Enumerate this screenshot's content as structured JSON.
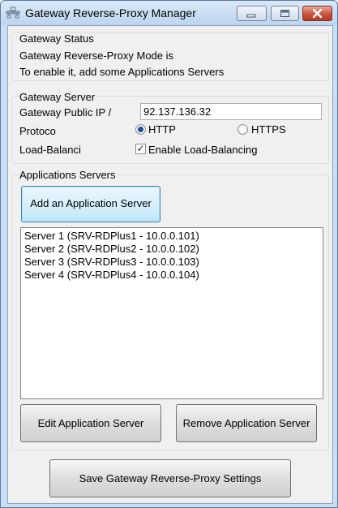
{
  "window": {
    "title": "Gateway Reverse-Proxy Manager",
    "icon": "network-gateway-icon"
  },
  "gateway_status": {
    "group_title": "Gateway Status",
    "line1": "Gateway Reverse-Proxy Mode is",
    "line2": "To enable it, add some Applications Servers"
  },
  "gateway_server": {
    "group_title": "Gateway Server",
    "public_ip_label": "Gateway Public IP /",
    "public_ip_value": "92.137.136.32",
    "protocol_label": "Protoco",
    "protocol_options": [
      "HTTP",
      "HTTPS"
    ],
    "protocol_selected": "HTTP",
    "load_balancing_label": "Load-Balanci",
    "load_balancing_checkbox_label": "Enable Load-Balancing",
    "load_balancing_checked": true
  },
  "applications_servers": {
    "group_title": "Applications Servers",
    "add_button": "Add an Application Server",
    "servers": [
      "Server 1 (SRV-RDPlus1 - 10.0.0.101)",
      "Server 2 (SRV-RDPlus2 - 10.0.0.102)",
      "Server 3 (SRV-RDPlus3 - 10.0.0.103)",
      "Server 4 (SRV-RDPlus4 - 10.0.0.104)"
    ],
    "edit_button": "Edit Application Server",
    "remove_button": "Remove Application Server"
  },
  "save_button": "Save Gateway Reverse-Proxy Settings"
}
